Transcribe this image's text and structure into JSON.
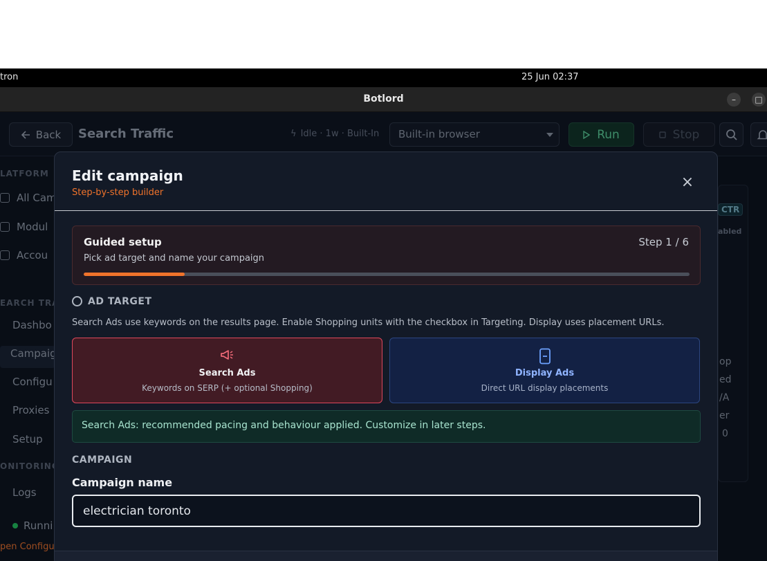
{
  "system": {
    "app_name": "tron",
    "clock": "25 Jun  02:37"
  },
  "window": {
    "title": "Botlord",
    "minimize": "–",
    "maximize": "□"
  },
  "header": {
    "back_label": "Back",
    "page_title": "Search Traffic",
    "status": "Idle · 1w · Built-In",
    "browser_select": "Built-in browser",
    "run_label": "Run",
    "stop_label": "Stop"
  },
  "sidebar": {
    "section_platform": "LATFORM",
    "items_platform": [
      "All Camp",
      "Modul",
      "Accou"
    ],
    "section_search": "EARCH TRA",
    "items_search": [
      "Dashbo",
      "Campaig",
      "Configu",
      "Proxies",
      "Setup"
    ],
    "section_monitoring": "ONITORING",
    "logs": "Logs",
    "running": "Runni",
    "open_config": "pen Configu"
  },
  "background": {
    "badge": "CTR",
    "enabled": "abled",
    "lines": [
      "op",
      "ed",
      "/A",
      "er",
      "0"
    ]
  },
  "modal": {
    "title": "Edit campaign",
    "subtitle": "Step-by-step builder",
    "close": "×",
    "guided": {
      "title": "Guided setup",
      "step": "Step 1 / 6",
      "description": "Pick ad target and name your campaign",
      "progress": 0.167
    },
    "ad_target": {
      "heading": "AD TARGET",
      "description": "Search Ads use keywords on the results page. Enable Shopping units with the checkbox in Targeting. Display uses placement URLs.",
      "options": [
        {
          "title": "Search Ads",
          "desc": "Keywords on SERP (+ optional Shopping)",
          "selected": true
        },
        {
          "title": "Display Ads",
          "desc": "Direct URL display placements",
          "selected": false
        }
      ]
    },
    "note": "Search Ads: recommended pacing and behaviour applied. Customize in later steps.",
    "campaign": {
      "heading": "CAMPAIGN",
      "name_label": "Campaign name",
      "name_value": "electrician toronto"
    }
  },
  "colors": {
    "accent": "#f0732b",
    "run_green": "#5fd59b",
    "search_card_border": "#e0485c",
    "display_card_text": "#8fb3ff"
  }
}
